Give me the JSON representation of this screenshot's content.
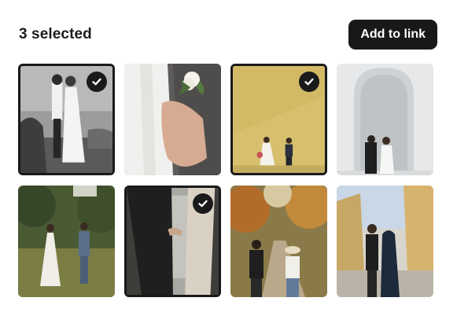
{
  "header": {
    "selected_count_label": "3 selected",
    "add_button_label": "Add to link"
  },
  "colors": {
    "accent": "#181818",
    "check_bg": "#1a1a1a",
    "background": "#ffffff"
  },
  "photos": [
    {
      "name": "photo-couple-bw-coast",
      "selected": true
    },
    {
      "name": "photo-boutonniere-closeup",
      "selected": false
    },
    {
      "name": "photo-couple-yellow-wall",
      "selected": true
    },
    {
      "name": "photo-couple-arched-doorway",
      "selected": false
    },
    {
      "name": "photo-couple-garden-bw-dress",
      "selected": false
    },
    {
      "name": "photo-couple-hands-window",
      "selected": true
    },
    {
      "name": "photo-couple-autumn-path",
      "selected": false
    },
    {
      "name": "photo-couple-modern-building",
      "selected": false
    }
  ]
}
